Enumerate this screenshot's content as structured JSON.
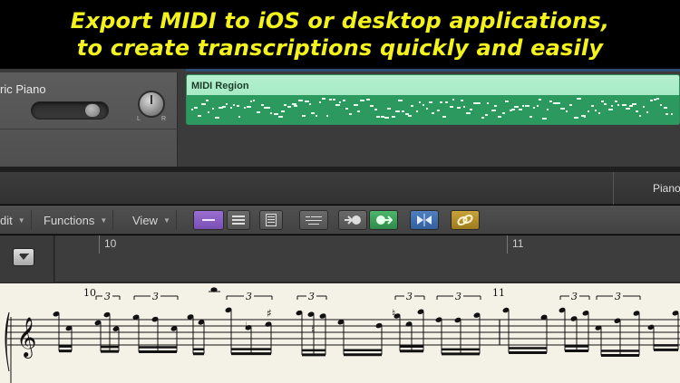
{
  "banner": {
    "line1": "Export MIDI to iOS or desktop applications,",
    "line2": "to create transcriptions quickly and easily",
    "text_color": "#f3f21a"
  },
  "track": {
    "name": "ric Piano",
    "pan_left_label": "L",
    "pan_right_label": "R"
  },
  "region": {
    "title": "MIDI Region",
    "color": "#8fe3b6"
  },
  "editor": {
    "track_label": "Piano"
  },
  "toolbar": {
    "menus": [
      {
        "label": "dit"
      },
      {
        "label": "Functions"
      },
      {
        "label": "View"
      }
    ],
    "tools": [
      {
        "icon": "single-staff-icon"
      },
      {
        "icon": "multi-staff-icon"
      },
      {
        "icon": "page-view-icon"
      },
      {
        "icon": "quantize-icon"
      },
      {
        "icon": "midi-in-icon"
      },
      {
        "icon": "midi-out-icon"
      },
      {
        "icon": "catch-icon"
      },
      {
        "icon": "link-icon"
      }
    ]
  },
  "score": {
    "bar_numbers": [
      "10",
      "11"
    ],
    "tuplet": "3",
    "clef": "treble-clef-icon"
  }
}
